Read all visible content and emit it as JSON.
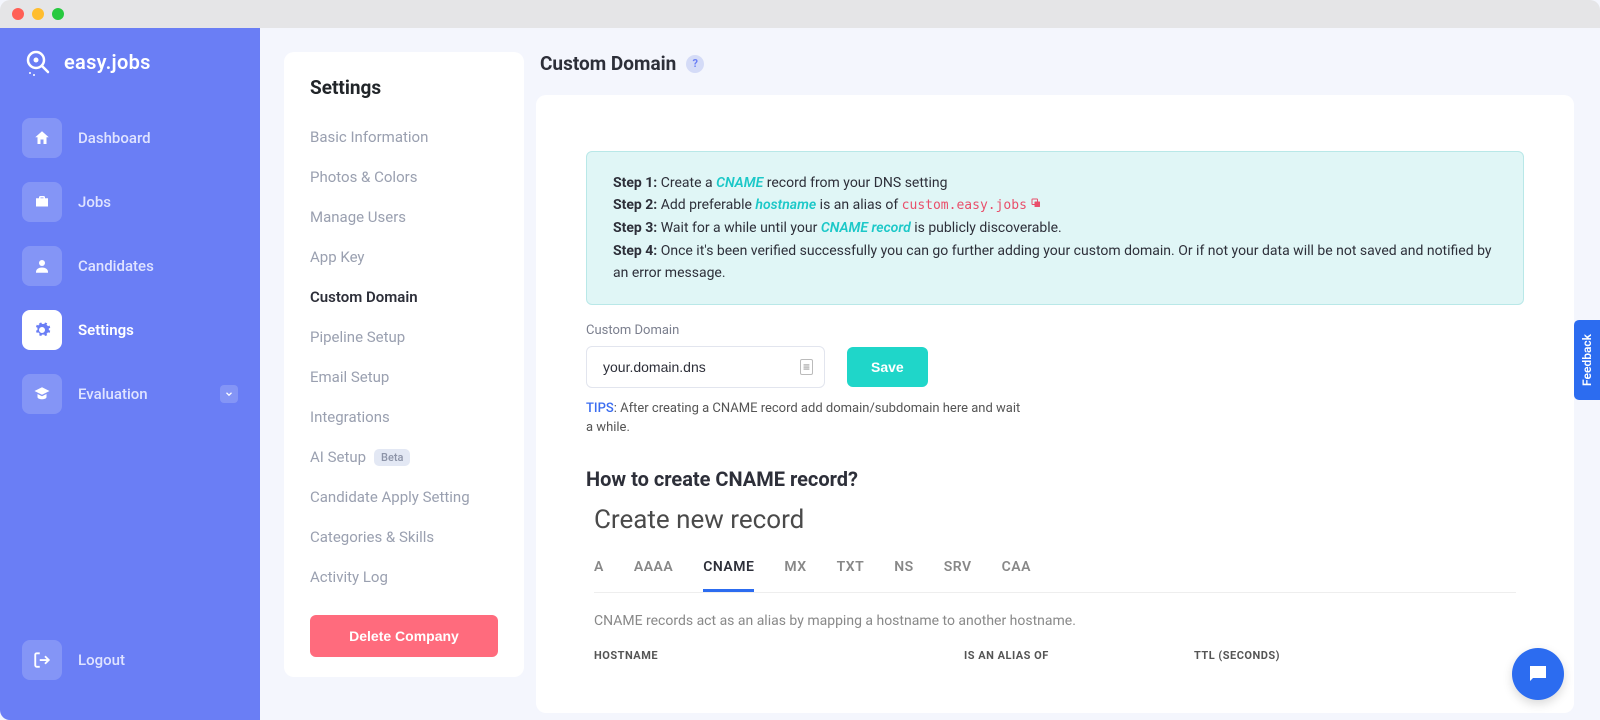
{
  "app_name": "easy.jobs",
  "sidebar": {
    "items": [
      {
        "label": "Dashboard",
        "icon": "home"
      },
      {
        "label": "Jobs",
        "icon": "briefcase"
      },
      {
        "label": "Candidates",
        "icon": "user"
      },
      {
        "label": "Settings",
        "icon": "gear",
        "active": true
      },
      {
        "label": "Evaluation",
        "icon": "grad-cap",
        "expandable": true
      }
    ],
    "logout": "Logout"
  },
  "settings": {
    "title": "Settings",
    "items": [
      "Basic Information",
      "Photos & Colors",
      "Manage Users",
      "App Key",
      "Custom Domain",
      "Pipeline Setup",
      "Email Setup",
      "Integrations",
      "AI Setup",
      "Candidate Apply Setting",
      "Categories & Skills",
      "Activity Log"
    ],
    "active_index": 4,
    "beta_index": 8,
    "beta_label": "Beta",
    "delete_button": "Delete Company"
  },
  "page": {
    "title": "Custom Domain",
    "info": {
      "step1_label": "Step 1:",
      "step1_a": " Create a ",
      "step1_cname": "CNAME",
      "step1_b": " record from your DNS setting",
      "step2_label": "Step 2:",
      "step2_a": " Add preferable ",
      "step2_hostname": "hostname",
      "step2_b": " is an alias of ",
      "step2_code": "custom.easy.jobs",
      "step3_label": "Step 3:",
      "step3_a": " Wait for a while until your ",
      "step3_cname": "CNAME record",
      "step3_b": " is publicly discoverable.",
      "step4_label": "Step 4:",
      "step4_a": " Once it's been verified successfully you can go further adding your custom domain. Or if not your data will be not saved and notified by an error message."
    },
    "field_label": "Custom Domain",
    "input_value": "your.domain.dns",
    "save_button": "Save",
    "tips_label": "TIPS",
    "tips_text": ": After creating a CNAME record add domain/subdomain here and wait a while.",
    "howto_title": "How to create CNAME record?",
    "dns": {
      "title": "Create new record",
      "tabs": [
        "A",
        "AAAA",
        "CNAME",
        "MX",
        "TXT",
        "NS",
        "SRV",
        "CAA"
      ],
      "active_tab": 2,
      "desc": "CNAME records act as an alias by mapping a hostname to another hostname.",
      "cols": [
        "HOSTNAME",
        "IS AN ALIAS OF",
        "TTL (SECONDS)"
      ]
    }
  },
  "feedback_label": "Feedback"
}
